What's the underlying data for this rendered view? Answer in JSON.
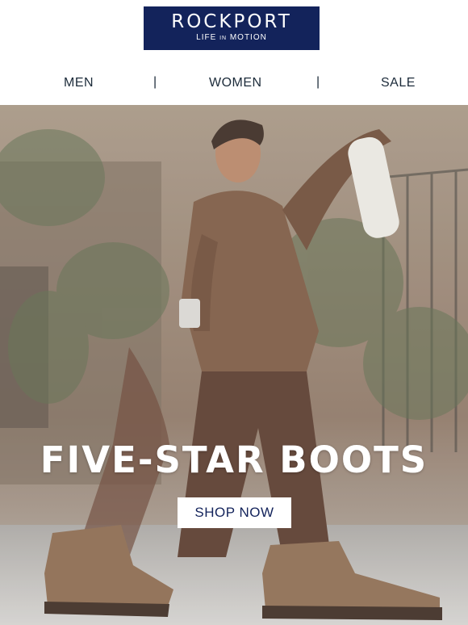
{
  "brand": {
    "name": "ROCKPORT",
    "tagline_pre": "LIFE",
    "tagline_mid": "IN",
    "tagline_post": "MOTION",
    "color": "#13235b"
  },
  "nav": {
    "items": [
      {
        "label": "MEN"
      },
      {
        "label": "WOMEN"
      },
      {
        "label": "SALE"
      }
    ],
    "separator": "|"
  },
  "hero": {
    "headline": "FIVE-STAR BOOTS",
    "cta_label": "SHOP NOW",
    "image": "photo-man-walking-in-brown-chukka-boots"
  }
}
